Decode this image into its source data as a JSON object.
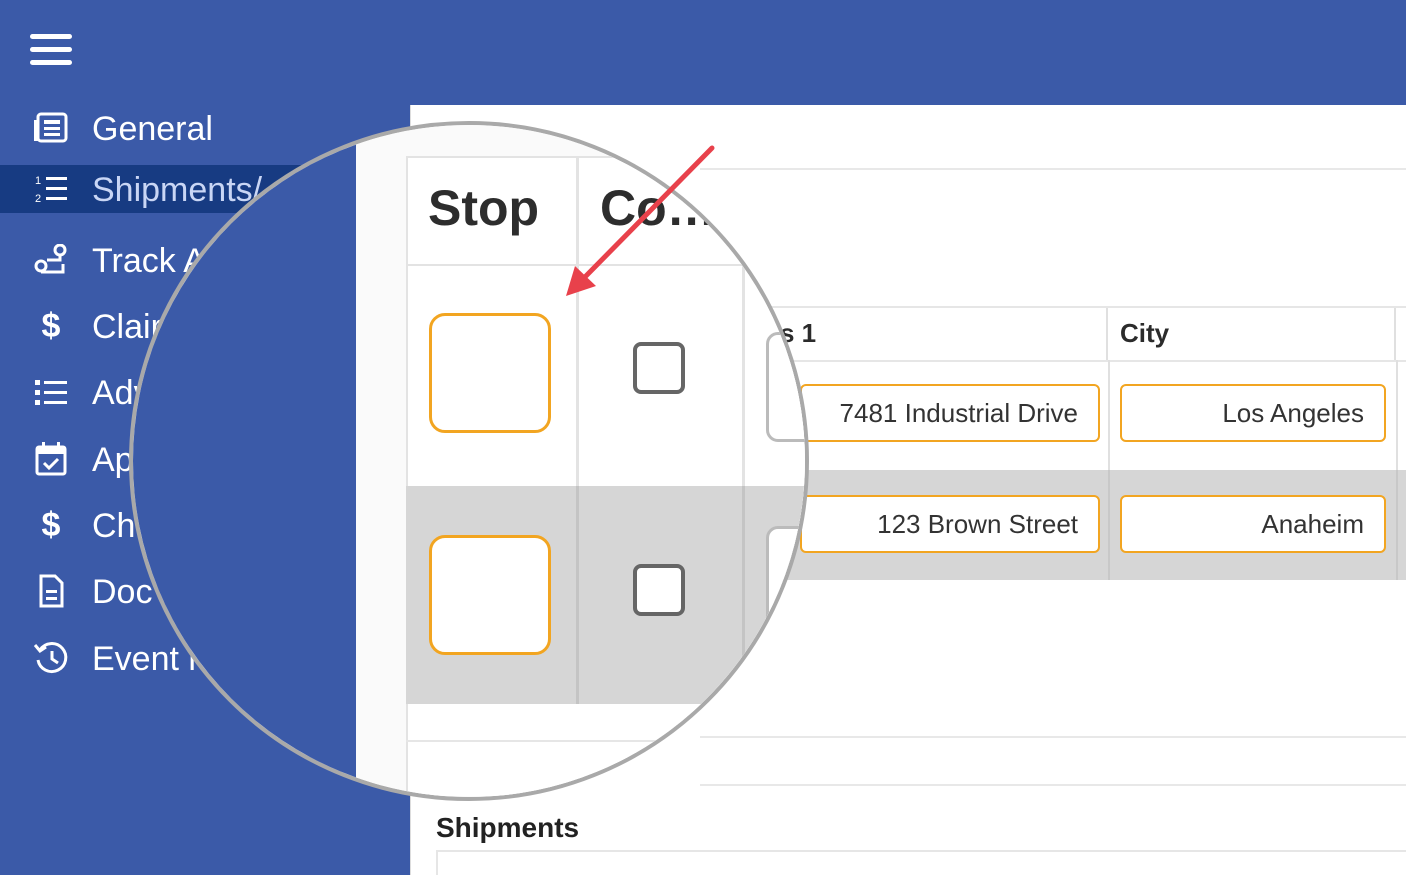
{
  "sidebar": {
    "menu_icon": "hamburger-icon",
    "items": [
      {
        "label": "General",
        "icon": "table-list-icon",
        "active": false
      },
      {
        "label": "Shipments/",
        "icon": "numbered-list-icon",
        "active": true
      },
      {
        "label": "Track A",
        "icon": "route-icon",
        "active": false
      },
      {
        "label": "Clair",
        "icon": "dollar-icon",
        "active": false
      },
      {
        "label": "Adv",
        "icon": "bullet-list-icon",
        "active": false
      },
      {
        "label": "Ap",
        "icon": "calendar-check-icon",
        "active": false
      },
      {
        "label": "Ch",
        "icon": "dollar-icon",
        "active": false
      },
      {
        "label": "Doc",
        "icon": "document-icon",
        "active": false
      },
      {
        "label": "Event l",
        "icon": "history-icon",
        "active": false
      }
    ]
  },
  "stops_table": {
    "columns": [
      "Stop",
      "Co…",
      "s 1",
      "City"
    ],
    "rows": [
      {
        "address": "7481 Industrial Drive",
        "city": "Los Angeles"
      },
      {
        "address": "123 Brown Street",
        "city": "Anaheim"
      }
    ]
  },
  "shipments_section": {
    "title": "Shipments"
  },
  "colors": {
    "sidebar_bg": "#3b5aa8",
    "active_item_bg": "#173b82",
    "input_border": "#f2a521",
    "arrow": "#e8414b"
  }
}
